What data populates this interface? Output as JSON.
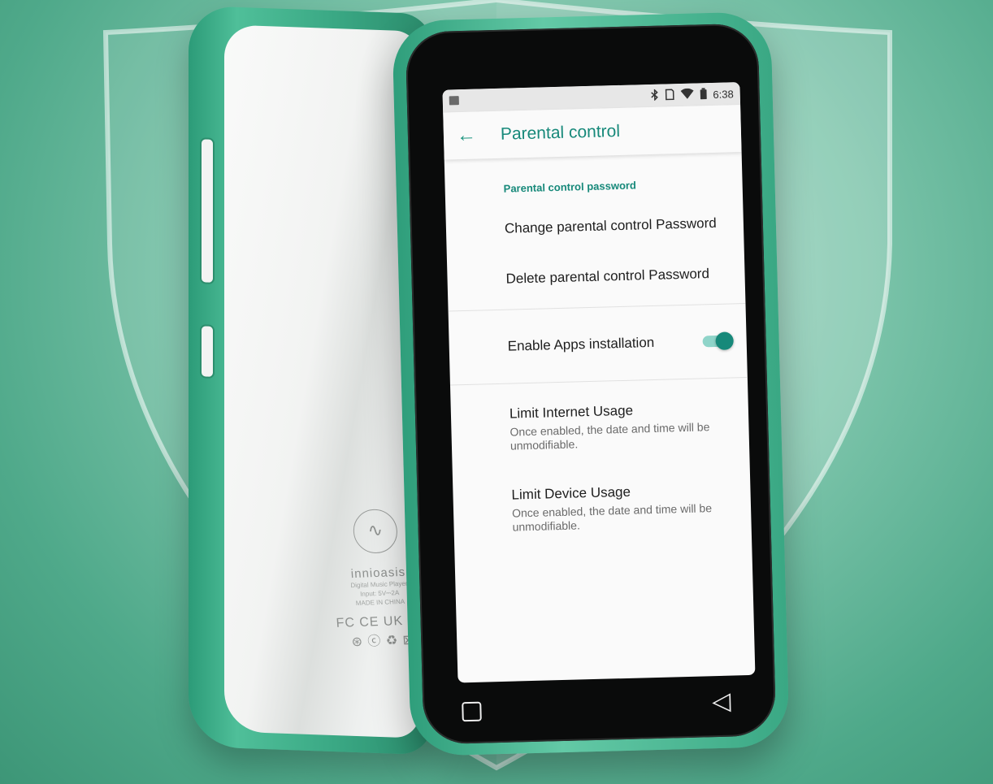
{
  "status_bar": {
    "time": "6:38",
    "icons": [
      "image-icon",
      "bluetooth-icon",
      "sd-card-icon",
      "wifi-icon",
      "battery-icon"
    ]
  },
  "app_bar": {
    "title": "Parental control",
    "back_icon": "arrow-left-icon"
  },
  "sections": {
    "password": {
      "header": "Parental control password",
      "change_label": "Change parental control Password",
      "delete_label": "Delete parental control Password"
    },
    "apps": {
      "enable_label": "Enable Apps installation",
      "enabled": true
    },
    "limits": {
      "internet_title": "Limit Internet Usage",
      "internet_summary": "Once enabled, the date and time will be unmodifiable.",
      "device_title": "Limit Device Usage",
      "device_summary": "Once enabled, the date and time will be unmodifiable."
    }
  },
  "nav_bar": {
    "buttons": [
      "recents-square-icon",
      "back-triangle-icon"
    ]
  },
  "device_back": {
    "brand": "innioasis",
    "lines": [
      "Digital Music Player",
      "Input: 5V⎓2A",
      "MADE IN CHINA"
    ],
    "certifications": "FC CE UK CA ⊛ ⓒ ♻ ⊠"
  },
  "colors": {
    "accent": "#17897a",
    "toggle_track": "#8fd4c9",
    "device_green": "#3aa884",
    "background": "#84c9b0"
  }
}
